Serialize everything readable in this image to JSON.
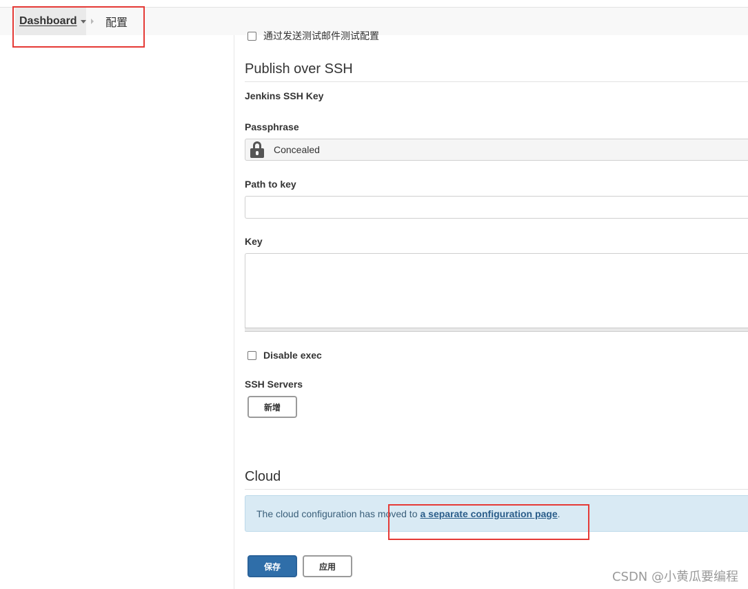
{
  "breadcrumb": {
    "dashboard": "Dashboard",
    "current": "配置"
  },
  "email": {
    "test_config_label": "通过发送测试邮件测试配置"
  },
  "publish_ssh": {
    "title": "Publish over SSH",
    "jenkins_ssh_key_label": "Jenkins SSH Key",
    "passphrase_label": "Passphrase",
    "passphrase_value": "Concealed",
    "path_to_key_label": "Path to key",
    "path_to_key_value": "",
    "key_label": "Key",
    "key_value": "",
    "disable_exec_label": "Disable exec",
    "disable_exec_checked": false,
    "ssh_servers_label": "SSH Servers",
    "add_button": "新增"
  },
  "cloud": {
    "title": "Cloud",
    "message": "The cloud configuration has moved to",
    "link_text": "a separate configuration page",
    "message_end": "."
  },
  "actions": {
    "save": "保存",
    "apply": "应用"
  },
  "watermark": "CSDN @小黄瓜要编程",
  "colors": {
    "highlight_box": "#e53935",
    "primary_button": "#2f6ea9",
    "info_background": "#d9eaf4"
  }
}
